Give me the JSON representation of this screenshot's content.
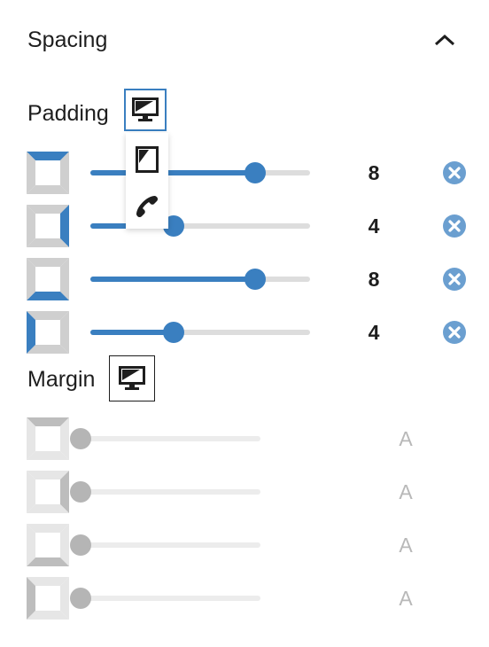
{
  "panel": {
    "title": "Spacing",
    "collapse_icon": "chevron-up-icon"
  },
  "padding": {
    "label": "Padding",
    "device_icon": "desktop-icon",
    "device_menu": [
      {
        "icon": "desktop-icon",
        "name": "Desktop"
      },
      {
        "icon": "tablet-icon",
        "name": "Tablet"
      },
      {
        "icon": "mobile-phone-icon",
        "name": "Mobile"
      }
    ],
    "sides": [
      {
        "side": "top",
        "value": "8",
        "fraction": 0.75
      },
      {
        "side": "right",
        "value": "4",
        "fraction": 0.38
      },
      {
        "side": "bottom",
        "value": "8",
        "fraction": 0.75
      },
      {
        "side": "left",
        "value": "4",
        "fraction": 0.38
      }
    ]
  },
  "margin": {
    "label": "Margin",
    "device_icon": "desktop-icon",
    "sides": [
      {
        "side": "top",
        "value": "A"
      },
      {
        "side": "right",
        "value": "A"
      },
      {
        "side": "bottom",
        "value": "A"
      },
      {
        "side": "left",
        "value": "A"
      }
    ]
  },
  "colors": {
    "accent": "#3a7fc0",
    "reset_icon": "#3a7fc0",
    "disabled": "#b5b5b5"
  }
}
